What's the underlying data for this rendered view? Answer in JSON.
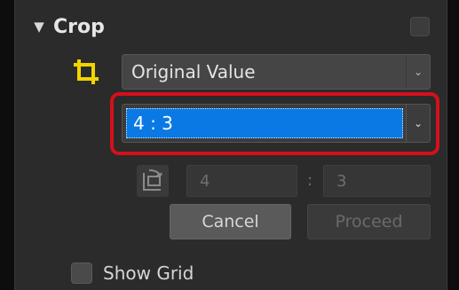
{
  "crop_section": {
    "title": "Crop",
    "expand_icon": "triangle-down-icon",
    "enable_toggle_checked": false
  },
  "crop_mode": {
    "icon": "crop-icon",
    "selected": "Original Value",
    "chevron": "chevron-down-icon"
  },
  "aspect_ratio": {
    "selected": "4 : 3",
    "chevron": "chevron-down-icon",
    "highlight_color": "#d4101b",
    "selection_color": "#0b79e3"
  },
  "custom_ratio": {
    "orientation_icon": "rotate-orientation-icon",
    "width": "4",
    "separator": ":",
    "height": "3"
  },
  "buttons": {
    "cancel": "Cancel",
    "proceed": "Proceed"
  },
  "show_grid": {
    "label": "Show Grid",
    "checked": false
  }
}
